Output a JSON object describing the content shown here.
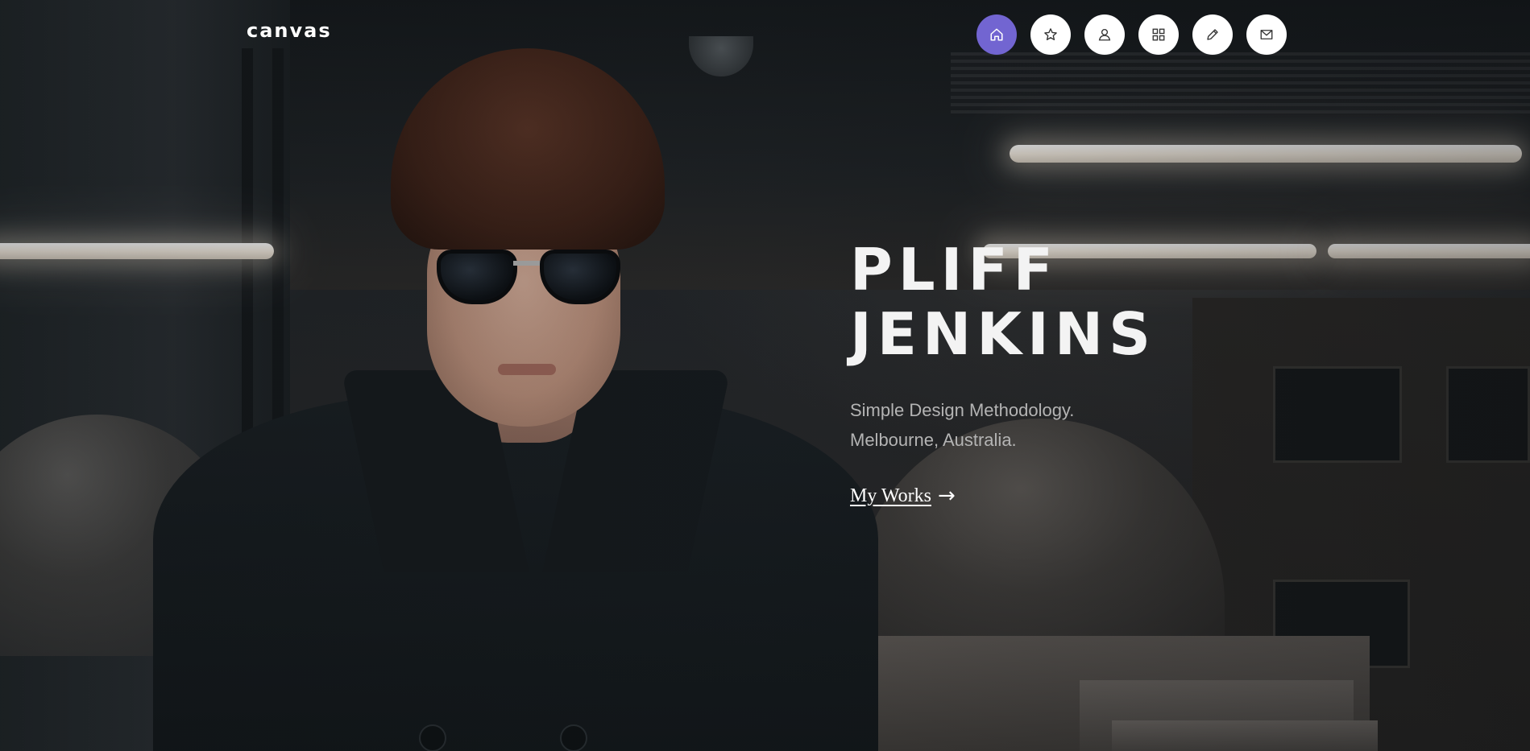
{
  "header": {
    "logo": "canvas",
    "nav": [
      {
        "icon": "home-icon",
        "active": true
      },
      {
        "icon": "star-icon",
        "active": false
      },
      {
        "icon": "user-icon",
        "active": false
      },
      {
        "icon": "grid-icon",
        "active": false
      },
      {
        "icon": "pencil-icon",
        "active": false
      },
      {
        "icon": "mail-icon",
        "active": false
      }
    ]
  },
  "hero": {
    "name_line1": "PLIFF",
    "name_line2": "JENKINS",
    "tagline_line1": "Simple Design Methodology.",
    "tagline_line2": "Melbourne, Australia.",
    "cta_label": "My Works",
    "cta_arrow": "→"
  },
  "colors": {
    "accent": "#7265d1",
    "nav_button": "#ffffff",
    "heading": "#f3f3f3",
    "tagline": "#b4b4b4"
  }
}
